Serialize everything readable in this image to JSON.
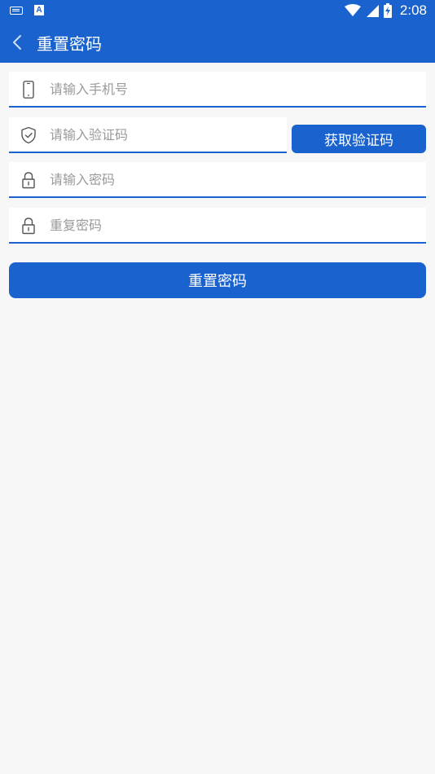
{
  "status_bar": {
    "time": "2:08",
    "left_icons": [
      "keyboard-icon",
      "a-app-icon"
    ],
    "right_icons": [
      "wifi-icon",
      "signal-icon",
      "battery-charging-icon"
    ]
  },
  "app_bar": {
    "title": "重置密码",
    "back_icon": "chevron-left-icon"
  },
  "form": {
    "phone": {
      "placeholder": "请输入手机号",
      "value": "",
      "icon": "phone-icon"
    },
    "code": {
      "placeholder": "请输入验证码",
      "value": "",
      "icon": "shield-icon"
    },
    "get_code_label": "获取验证码",
    "password": {
      "placeholder": "请输入密码",
      "value": "",
      "icon": "lock-icon"
    },
    "confirm_password": {
      "placeholder": "重复密码",
      "value": "",
      "icon": "lock-icon"
    },
    "submit_label": "重置密码"
  },
  "colors": {
    "primary": "#1a63cf",
    "background": "#f7f7f7",
    "field_background": "#ffffff",
    "placeholder": "#9a9a9a"
  }
}
